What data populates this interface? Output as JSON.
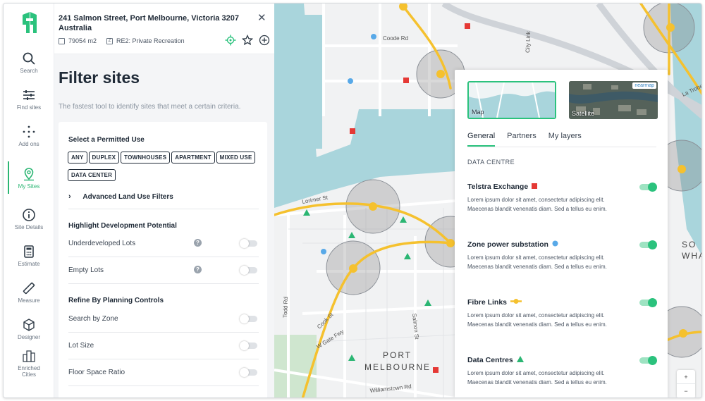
{
  "colors": {
    "accent": "#2bc27d",
    "text": "#1f2a37",
    "road": "#f5c12e",
    "marker_red": "#e53935",
    "marker_blue": "#58a9e8",
    "marker_green": "#2bb673"
  },
  "rail": {
    "items": [
      {
        "label": "Search",
        "icon": "search-icon"
      },
      {
        "label": "Find sites",
        "icon": "sliders-icon"
      },
      {
        "label": "Add ons",
        "icon": "add-ons-icon"
      },
      {
        "label": "My Sites",
        "icon": "location-pin-icon"
      },
      {
        "label": "Site Details",
        "icon": "info-icon"
      },
      {
        "label": "Estimate",
        "icon": "calculator-icon"
      },
      {
        "label": "Measure",
        "icon": "ruler-icon"
      },
      {
        "label": "Designer",
        "icon": "cube-icon"
      },
      {
        "label": "Enriched Cities",
        "icon": "city-icon"
      }
    ]
  },
  "address": {
    "title": "241 Salmon Street, Port Melbourne, Victoria 3207 Australia",
    "area": "79054 m2",
    "zone": "RE2: Private Recreation"
  },
  "filter": {
    "title": "Filter sites",
    "subtitle": "The fastest tool to identify sites that meet a certain criteria.",
    "permitted_use_heading": "Select a Permitted Use",
    "chips": [
      "ANY",
      "DUPLEX",
      "TOWNHOUSES",
      "APARTMENT",
      "MIXED USE",
      "DATA CENTER"
    ],
    "advanced": "Advanced Land Use Filters",
    "highlight_heading": "Highlight Development Potential",
    "highlight_rows": [
      {
        "label": "Underdeveloped Lots",
        "on": false
      },
      {
        "label": "Empty Lots",
        "on": false
      }
    ],
    "refine_heading": "Refine By Planning Controls",
    "refine_rows": [
      {
        "label": "Search by Zone",
        "on": false
      },
      {
        "label": "Lot Size",
        "on": false
      },
      {
        "label": "Floor Space Ratio",
        "on": false
      }
    ]
  },
  "map": {
    "streets": [
      "Coode Rd",
      "City Link",
      "Lorimer St",
      "Todd Rd",
      "Cook St",
      "W Gate Fwy",
      "Salmon St",
      "Williamstown Rd",
      "La Trobe St"
    ],
    "suburb_line1": "PORT",
    "suburb_line2": "MELBOURNE",
    "edge_label_1": "SO",
    "edge_label_2": "WHA"
  },
  "layers": {
    "basemaps": [
      {
        "label": "Map"
      },
      {
        "label": "Satellite"
      }
    ],
    "brand_badge": "nearmap",
    "tabs": [
      "General",
      "Partners",
      "My layers"
    ],
    "section": "DATA CENTRE",
    "items": [
      {
        "name": "Telstra Exchange",
        "symbol": "red-square",
        "desc": "Lorem ipsum dolor sit amet, consectetur adipiscing elit. Maecenas blandit venenatis diam. Sed a tellus eu enim.",
        "on": true
      },
      {
        "name": "Zone power substation",
        "symbol": "blue-circle",
        "desc": "Lorem ipsum dolor sit amet, consectetur adipiscing elit. Maecenas blandit venenatis diam. Sed a tellus eu enim.",
        "on": true
      },
      {
        "name": "Fibre Links",
        "symbol": "yellow-line",
        "desc": "Lorem ipsum dolor sit amet, consectetur adipiscing elit. Maecenas blandit venenatis diam. Sed a tellus eu enim.",
        "on": true
      },
      {
        "name": "Data Centres",
        "symbol": "green-triangle",
        "desc": "Lorem ipsum dolor sit amet, consectetur adipiscing elit. Maecenas blandit venenatis diam. Sed a tellus eu enim.",
        "on": true
      }
    ]
  },
  "zoom": {
    "plus": "+",
    "minus": "−"
  }
}
